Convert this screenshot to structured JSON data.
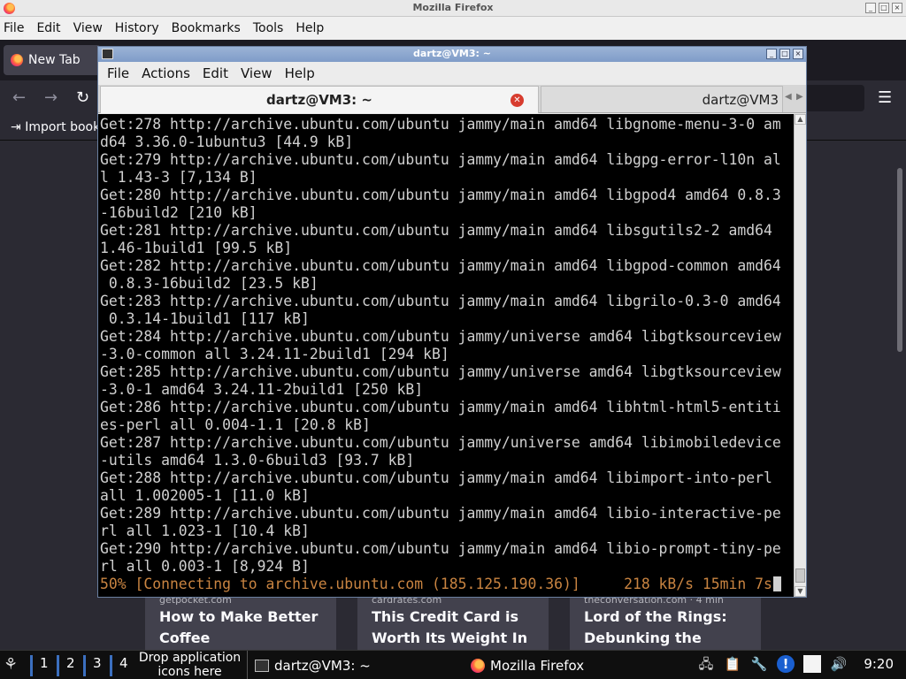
{
  "firefox": {
    "window_title": "Mozilla Firefox",
    "menu": [
      "File",
      "Edit",
      "View",
      "History",
      "Bookmarks",
      "Tools",
      "Help"
    ],
    "tab_label": "New Tab",
    "bookmark_label": "Import book",
    "cards": [
      {
        "source": "getpocket.com",
        "title_line1": "How to Make Better",
        "title_line2": "Coffee"
      },
      {
        "source": "cardrates.com",
        "title_line1": "This Credit Card is",
        "title_line2": "Worth Its Weight In"
      },
      {
        "source": "theconversation.com · 4 min",
        "title_line1": "Lord of the Rings:",
        "title_line2": "Debunking the"
      }
    ]
  },
  "terminal": {
    "window_title": "dartz@VM3: ~",
    "menu": [
      "File",
      "Actions",
      "Edit",
      "View",
      "Help"
    ],
    "tabs": [
      {
        "label": "dartz@VM3: ~",
        "active": true
      },
      {
        "label": "dartz@VM3",
        "active": false
      }
    ],
    "lines": [
      "Get:278 http://archive.ubuntu.com/ubuntu jammy/main amd64 libgnome-menu-3-0 am",
      "d64 3.36.0-1ubuntu3 [44.9 kB]",
      "Get:279 http://archive.ubuntu.com/ubuntu jammy/main amd64 libgpg-error-l10n al",
      "l 1.43-3 [7,134 B]",
      "Get:280 http://archive.ubuntu.com/ubuntu jammy/main amd64 libgpod4 amd64 0.8.3",
      "-16build2 [210 kB]",
      "Get:281 http://archive.ubuntu.com/ubuntu jammy/main amd64 libsgutils2-2 amd64",
      "1.46-1build1 [99.5 kB]",
      "Get:282 http://archive.ubuntu.com/ubuntu jammy/main amd64 libgpod-common amd64",
      " 0.8.3-16build2 [23.5 kB]",
      "Get:283 http://archive.ubuntu.com/ubuntu jammy/main amd64 libgrilo-0.3-0 amd64",
      " 0.3.14-1build1 [117 kB]",
      "Get:284 http://archive.ubuntu.com/ubuntu jammy/universe amd64 libgtksourceview",
      "-3.0-common all 3.24.11-2build1 [294 kB]",
      "Get:285 http://archive.ubuntu.com/ubuntu jammy/universe amd64 libgtksourceview",
      "-3.0-1 amd64 3.24.11-2build1 [250 kB]",
      "Get:286 http://archive.ubuntu.com/ubuntu jammy/main amd64 libhtml-html5-entiti",
      "es-perl all 0.004-1.1 [20.8 kB]",
      "Get:287 http://archive.ubuntu.com/ubuntu jammy/universe amd64 libimobiledevice",
      "-utils amd64 1.3.0-6build3 [93.7 kB]",
      "Get:288 http://archive.ubuntu.com/ubuntu jammy/main amd64 libimport-into-perl",
      "all 1.002005-1 [11.0 kB]",
      "Get:289 http://archive.ubuntu.com/ubuntu jammy/main amd64 libio-interactive-pe",
      "rl all 1.023-1 [10.4 kB]",
      "Get:290 http://archive.ubuntu.com/ubuntu jammy/main amd64 libio-prompt-tiny-pe",
      "rl all 0.003-1 [8,924 B]"
    ],
    "status_line": "50% [Connecting to archive.ubuntu.com (185.125.190.36)]     218 kB/s 15min 7s",
    "status_color": "#c98441"
  },
  "taskbar": {
    "workspaces": [
      "1",
      "2",
      "3",
      "4"
    ],
    "drop_hint_line1": "Drop application",
    "drop_hint_line2": "icons here",
    "tasks": [
      {
        "label": "dartz@VM3: ~",
        "icon": "terminal-icon"
      },
      {
        "label": "Mozilla Firefox",
        "icon": "firefox-icon"
      }
    ],
    "tray_icons": [
      "network-icon",
      "clipboard-icon",
      "tools-icon",
      "info-icon",
      "notes-icon",
      "volume-icon"
    ],
    "clock": "9:20"
  }
}
